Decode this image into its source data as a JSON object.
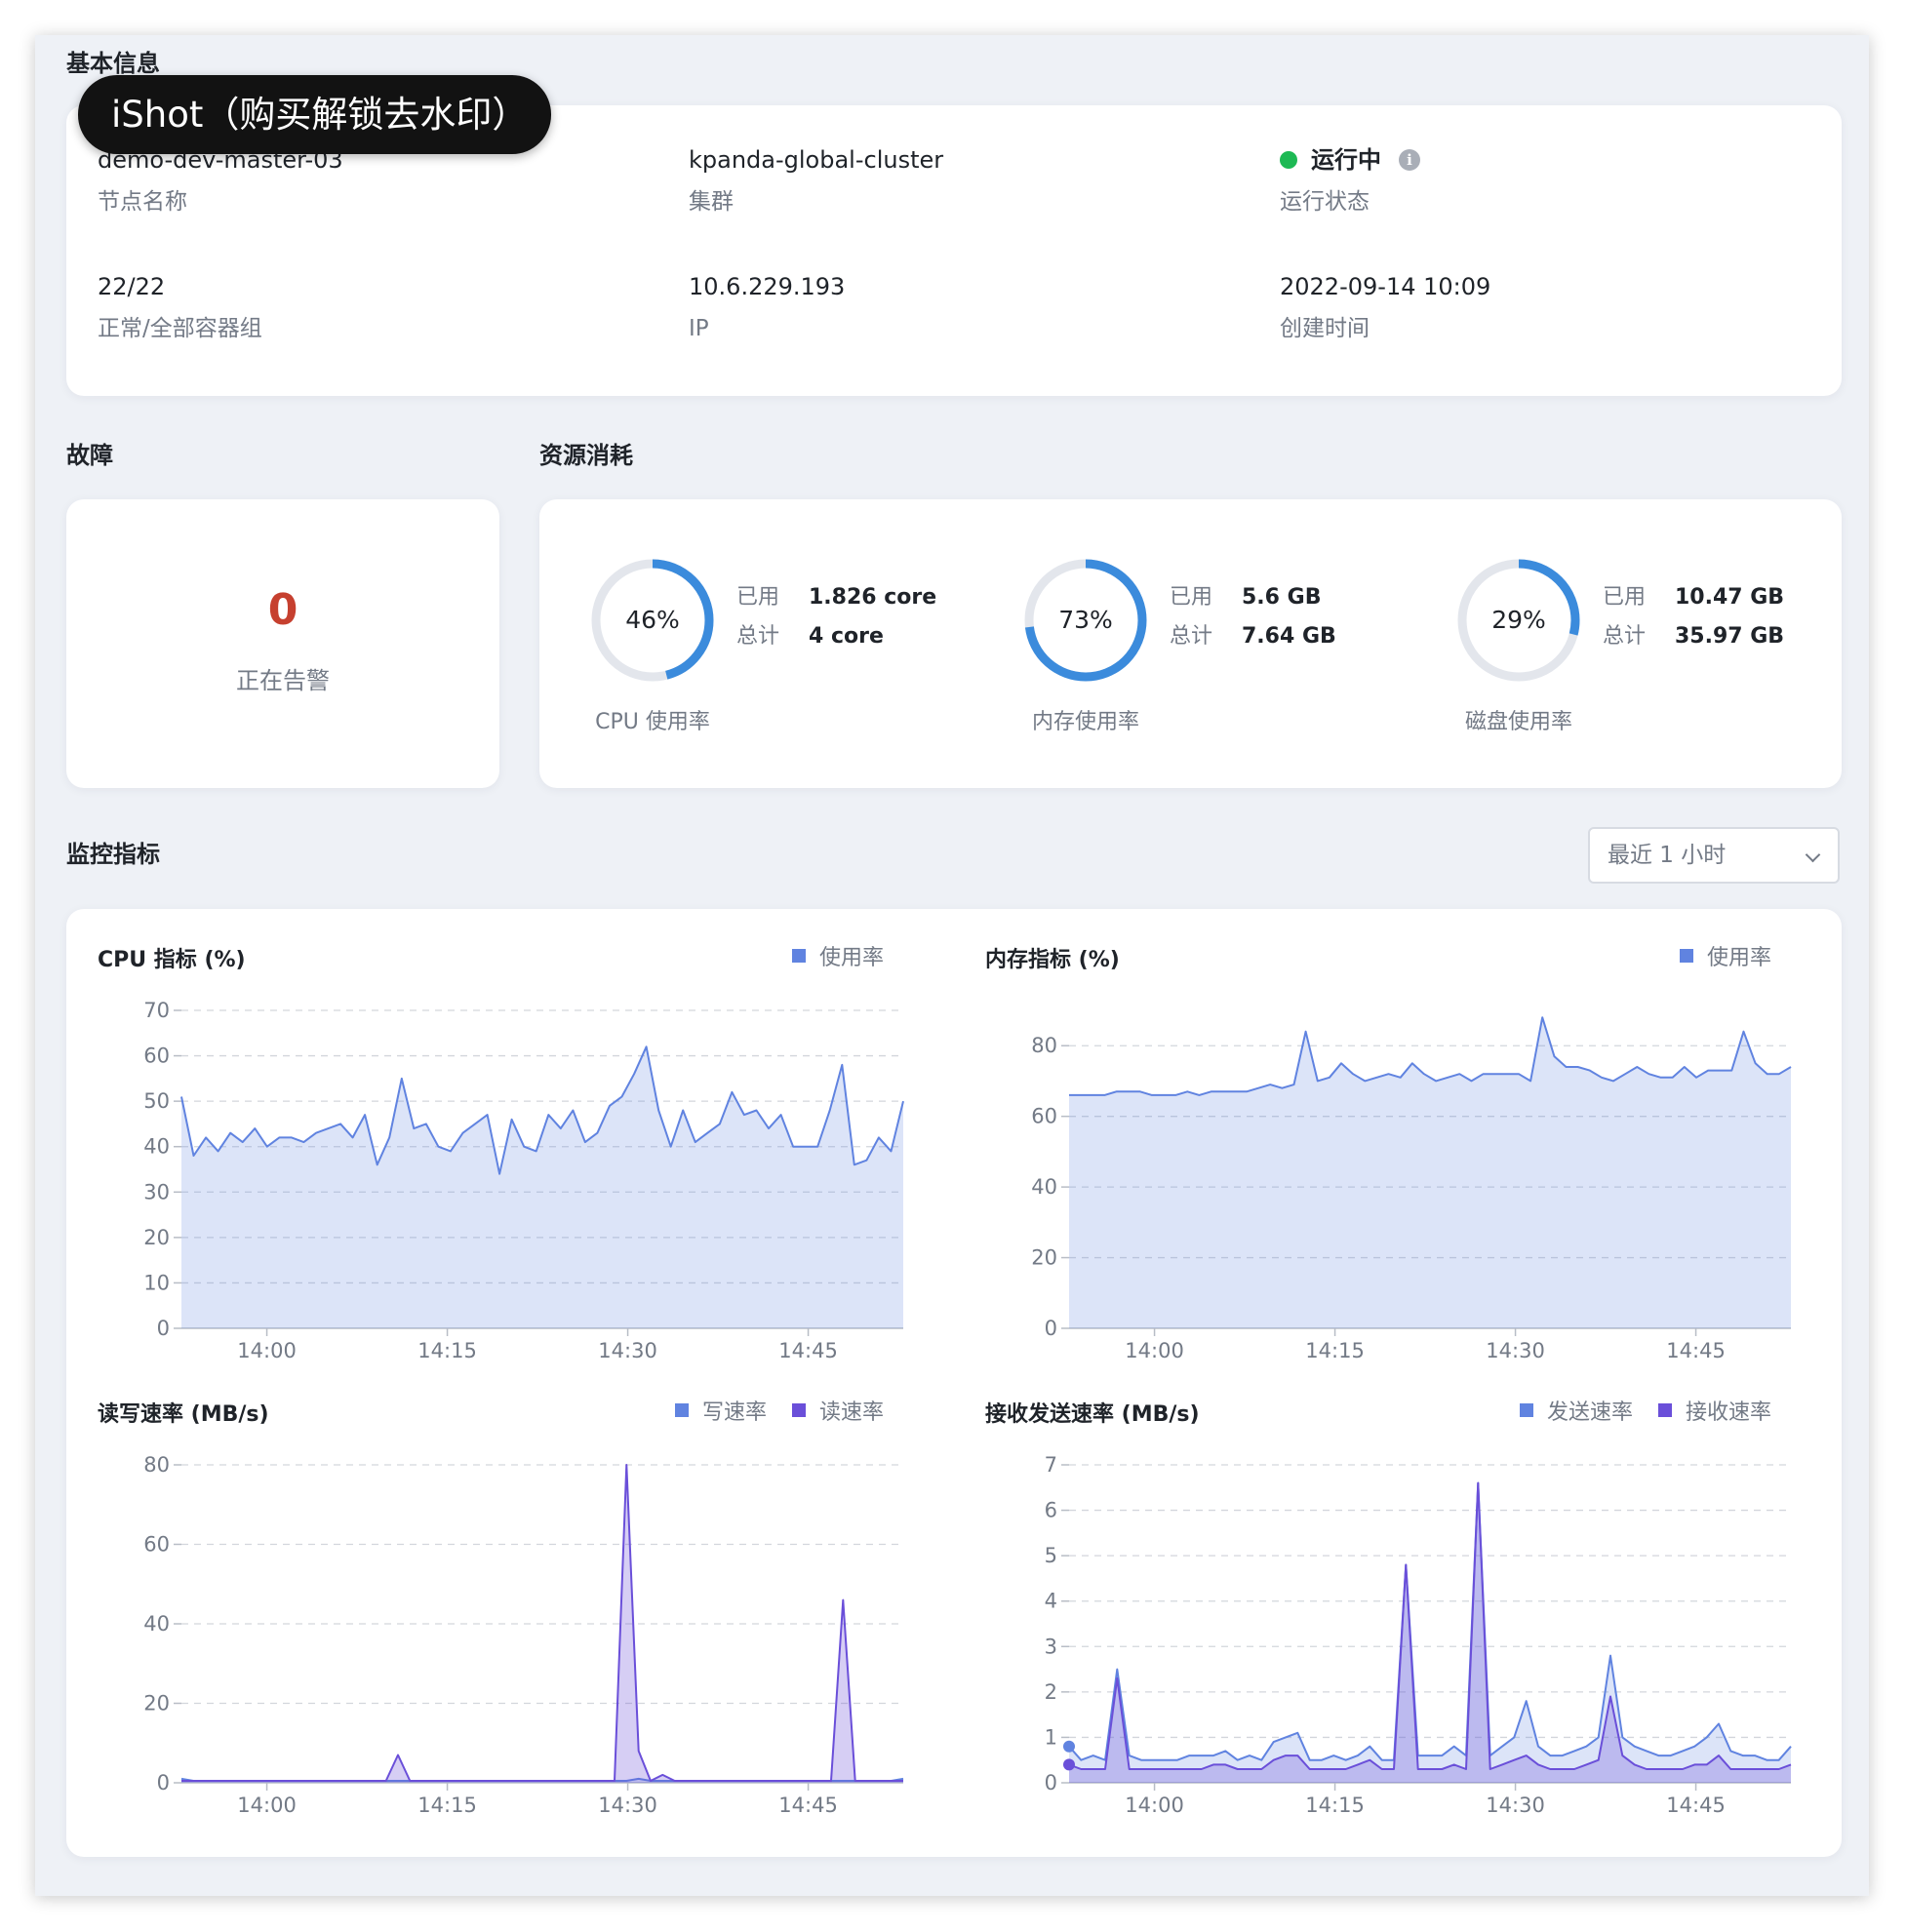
{
  "sections": {
    "basic_info": "基本信息",
    "faults": "故障",
    "resources": "资源消耗",
    "monitoring": "监控指标"
  },
  "watermark": "iShot（购买解锁去水印）",
  "basic_info": {
    "node_name": {
      "value": "demo-dev-master-03",
      "label": "节点名称"
    },
    "cluster": {
      "value": "kpanda-global-cluster",
      "label": "集群"
    },
    "status": {
      "value": "运行中",
      "label": "运行状态",
      "color": "#1db954",
      "icon": "info-icon"
    },
    "pods": {
      "value": "22/22",
      "label": "正常/全部容器组"
    },
    "ip": {
      "value": "10.6.229.193",
      "label": "IP"
    },
    "created": {
      "value": "2022-09-14 10:09",
      "label": "创建时间"
    }
  },
  "faults": {
    "count": "0",
    "label": "正在告警",
    "color": "#c6402f"
  },
  "resources": [
    {
      "pct_text": "46%",
      "pct": 0.46,
      "used_label": "已用",
      "used": "1.826 core",
      "total_label": "总计",
      "total": "4 core",
      "label": "CPU 使用率"
    },
    {
      "pct_text": "73%",
      "pct": 0.73,
      "used_label": "已用",
      "used": "5.6 GB",
      "total_label": "总计",
      "total": "7.64 GB",
      "label": "内存使用率"
    },
    {
      "pct_text": "29%",
      "pct": 0.29,
      "used_label": "已用",
      "used": "10.47 GB",
      "total_label": "总计",
      "total": "35.97 GB",
      "label": "磁盘使用率"
    }
  ],
  "time_range": {
    "selected": "最近 1 小时",
    "icon": "chevron-down-icon"
  },
  "colors": {
    "accent": "#3b8bdc",
    "ring_track": "#e3e6ec",
    "series_blue": "#6083e0",
    "series_purple": "#6a4fd9"
  },
  "chart_data": [
    {
      "type": "area",
      "title": "CPU 指标 (%)",
      "ylim": [
        0,
        70
      ],
      "yticks": [
        0,
        10,
        20,
        30,
        40,
        50,
        60,
        70
      ],
      "x_tick_labels": [
        "14:00",
        "14:15",
        "14:30",
        "14:45"
      ],
      "x_tick_minutes": [
        0,
        15,
        30,
        45
      ],
      "x_range_minutes": [
        -7.1,
        52.9
      ],
      "grid": true,
      "legend_position": "top-right",
      "series": [
        {
          "name": "使用率",
          "color": "#6083e0",
          "values": [
            51,
            38,
            42,
            39,
            43,
            41,
            44,
            40,
            42,
            42,
            41,
            43,
            44,
            45,
            42,
            47,
            36,
            42,
            55,
            44,
            45,
            40,
            39,
            43,
            45,
            47,
            34,
            46,
            40,
            39,
            47,
            44,
            48,
            41,
            43,
            49,
            51,
            56,
            62,
            48,
            40,
            48,
            41,
            43,
            45,
            52,
            47,
            48,
            44,
            47,
            40,
            40,
            40,
            48,
            58,
            36,
            37,
            42,
            39,
            50
          ]
        }
      ]
    },
    {
      "type": "area",
      "title": "内存指标 (%)",
      "ylim": [
        0,
        90
      ],
      "yticks": [
        0,
        20,
        40,
        60,
        80
      ],
      "x_tick_labels": [
        "14:00",
        "14:15",
        "14:30",
        "14:45"
      ],
      "x_tick_minutes": [
        0,
        15,
        30,
        45
      ],
      "x_range_minutes": [
        -7.1,
        52.9
      ],
      "grid": true,
      "legend_position": "top-right",
      "series": [
        {
          "name": "使用率",
          "color": "#6083e0",
          "values": [
            66,
            66,
            66,
            66,
            67,
            67,
            67,
            66,
            66,
            66,
            67,
            66,
            67,
            67,
            67,
            67,
            68,
            69,
            68,
            69,
            84,
            70,
            71,
            75,
            72,
            70,
            71,
            72,
            71,
            75,
            72,
            70,
            71,
            72,
            70,
            72,
            72,
            72,
            72,
            70,
            88,
            77,
            74,
            74,
            73,
            71,
            70,
            72,
            74,
            72,
            71,
            71,
            74,
            71,
            73,
            73,
            73,
            84,
            75,
            72,
            72,
            74
          ]
        }
      ]
    },
    {
      "type": "area",
      "title": "读写速率 (MB/s)",
      "ylim": [
        0,
        80
      ],
      "yticks": [
        0,
        20,
        40,
        60,
        80
      ],
      "x_tick_labels": [
        "14:00",
        "14:15",
        "14:30",
        "14:45"
      ],
      "x_tick_minutes": [
        0,
        15,
        30,
        45
      ],
      "x_range_minutes": [
        -7.1,
        52.9
      ],
      "grid": true,
      "legend_position": "top-right",
      "series": [
        {
          "name": "写速率",
          "color": "#6083e0",
          "values": [
            1,
            0.5,
            0.5,
            0.5,
            0.5,
            0.5,
            0.5,
            0.5,
            0.5,
            0.5,
            0.5,
            0.5,
            0.5,
            0.5,
            0.5,
            0.5,
            0.5,
            0.5,
            0.5,
            0.5,
            0.5,
            0.5,
            0.5,
            0.5,
            0.5,
            0.5,
            0.5,
            0.5,
            0.5,
            0.5,
            0.5,
            0.5,
            0.5,
            0.5,
            0.5,
            0.5,
            0.5,
            0.5,
            1,
            0.5,
            0.5,
            0.5,
            0.5,
            0.5,
            0.5,
            0.5,
            0.5,
            0.5,
            0.5,
            0.5,
            0.5,
            0.5,
            0.5,
            0.5,
            0.5,
            0.5,
            0.5,
            0.5,
            0.5,
            0.5,
            1
          ]
        },
        {
          "name": "读速率",
          "color": "#6a4fd9",
          "values": [
            0.5,
            0.5,
            0.5,
            0.5,
            0.5,
            0.5,
            0.5,
            0.5,
            0.5,
            0.5,
            0.5,
            0.5,
            0.5,
            0.5,
            0.5,
            0.5,
            0.5,
            0.5,
            7,
            0.5,
            0.5,
            0.5,
            0.5,
            0.5,
            0.5,
            0.5,
            0.5,
            0.5,
            0.5,
            0.5,
            0.5,
            0.5,
            0.5,
            0.5,
            0.5,
            0.5,
            0.5,
            80,
            8,
            0.5,
            2,
            0.5,
            0.5,
            0.5,
            0.5,
            0.5,
            0.5,
            0.5,
            0.5,
            0.5,
            0.5,
            0.5,
            0.5,
            0.5,
            0.5,
            46,
            0.5,
            0.5,
            0.5,
            0.5,
            0.5
          ]
        }
      ]
    },
    {
      "type": "area",
      "title": "接收发送速率 (MB/s)",
      "ylim": [
        0,
        7
      ],
      "yticks": [
        0,
        1,
        2,
        3,
        4,
        5,
        6,
        7
      ],
      "x_tick_labels": [
        "14:00",
        "14:15",
        "14:30",
        "14:45"
      ],
      "x_tick_minutes": [
        0,
        15,
        30,
        45
      ],
      "x_range_minutes": [
        -7.1,
        52.9
      ],
      "grid": true,
      "legend_position": "top-right",
      "series": [
        {
          "name": "发送速率",
          "color": "#6083e0",
          "values": [
            0.8,
            0.5,
            0.6,
            0.5,
            2.5,
            0.6,
            0.5,
            0.5,
            0.5,
            0.5,
            0.6,
            0.6,
            0.6,
            0.7,
            0.5,
            0.6,
            0.5,
            0.9,
            1.0,
            1.1,
            0.5,
            0.5,
            0.6,
            0.5,
            0.6,
            0.8,
            0.5,
            0.5,
            4.8,
            0.6,
            0.6,
            0.6,
            0.8,
            0.6,
            6.6,
            0.6,
            0.8,
            1.0,
            1.8,
            0.8,
            0.6,
            0.6,
            0.7,
            0.8,
            1.0,
            2.8,
            1.0,
            0.8,
            0.7,
            0.6,
            0.6,
            0.7,
            0.8,
            1.0,
            1.3,
            0.7,
            0.6,
            0.6,
            0.5,
            0.5,
            0.8
          ]
        },
        {
          "name": "接收速率",
          "color": "#6a4fd9",
          "values": [
            0.4,
            0.3,
            0.3,
            0.3,
            2.3,
            0.3,
            0.3,
            0.3,
            0.3,
            0.3,
            0.3,
            0.3,
            0.4,
            0.4,
            0.3,
            0.3,
            0.3,
            0.5,
            0.6,
            0.6,
            0.3,
            0.3,
            0.3,
            0.3,
            0.4,
            0.5,
            0.3,
            0.3,
            4.8,
            0.3,
            0.3,
            0.3,
            0.4,
            0.3,
            6.6,
            0.3,
            0.4,
            0.5,
            0.6,
            0.4,
            0.3,
            0.3,
            0.3,
            0.4,
            0.5,
            1.9,
            0.6,
            0.4,
            0.3,
            0.3,
            0.3,
            0.3,
            0.4,
            0.4,
            0.6,
            0.3,
            0.3,
            0.3,
            0.3,
            0.3,
            0.4
          ]
        }
      ]
    }
  ]
}
